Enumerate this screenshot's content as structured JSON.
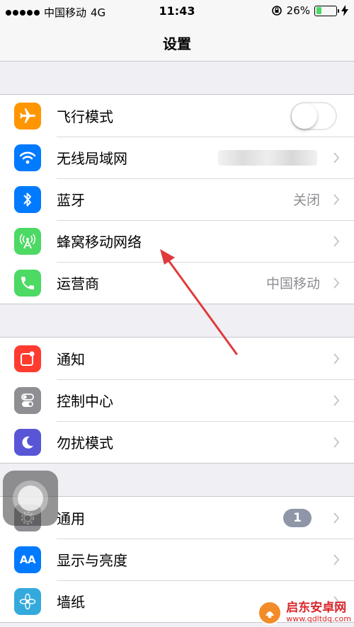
{
  "status_bar": {
    "carrier": "中国移动",
    "network": "4G",
    "time": "11:43",
    "battery": "26%",
    "battery_level": 0.26
  },
  "nav": {
    "title": "设置"
  },
  "groups": [
    {
      "rows": [
        {
          "label": "飞行模式",
          "icon": "airplane-icon",
          "color": "#ff9500",
          "toggle": false
        },
        {
          "label": "无线局域网",
          "icon": "wifi-icon",
          "color": "#007aff"
        },
        {
          "label": "蓝牙",
          "icon": "bluetooth-icon",
          "color": "#007aff",
          "value": "关闭"
        },
        {
          "label": "蜂窝移动网络",
          "icon": "cellular-icon",
          "color": "#4cd964"
        },
        {
          "label": "运营商",
          "icon": "phone-icon",
          "color": "#4cd964",
          "value": "中国移动"
        }
      ]
    },
    {
      "rows": [
        {
          "label": "通知",
          "icon": "notifications-icon",
          "color": "#ff3b30"
        },
        {
          "label": "控制中心",
          "icon": "control-center-icon",
          "color": "#8e8e93"
        },
        {
          "label": "勿扰模式",
          "icon": "moon-icon",
          "color": "#5856d6"
        }
      ]
    },
    {
      "rows": [
        {
          "label": "通用",
          "icon": "gear-icon",
          "color": "#8e8e93",
          "badge": "1"
        },
        {
          "label": "显示与亮度",
          "icon": "display-icon",
          "color": "#007aff",
          "icon_text": "AA"
        },
        {
          "label": "墙纸",
          "icon": "wallpaper-icon",
          "color": "#34aadc"
        }
      ]
    }
  ],
  "watermark": {
    "name": "启东安卓网",
    "url": "www.qdltdq.com"
  }
}
